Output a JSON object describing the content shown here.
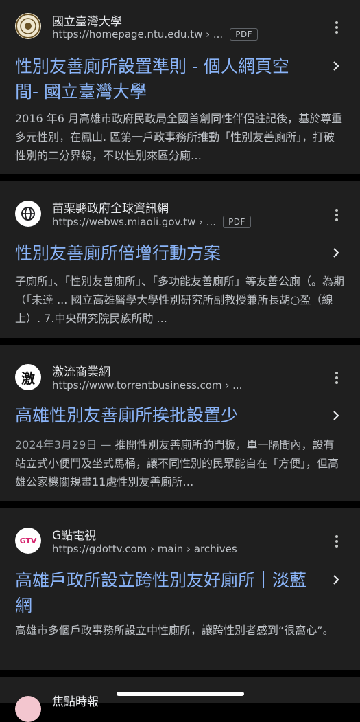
{
  "results": [
    {
      "site_name": "國立臺灣大學",
      "url": "https://homepage.ntu.edu.tw › ...",
      "badge": "PDF",
      "favicon": "ntu-seal-icon",
      "title": "性別友善廁所設置準則 - 個人網頁空間- 國立臺灣大學",
      "snippet": "2016 年6 月高雄市政府民政局全國首創同性伴侶註記後，基於尊重多元性別，在鳳山. 區第一戶政事務所推動「性別友善廁所」，打破性別的二分界線，不以性別來區分廁…"
    },
    {
      "site_name": "苗栗縣政府全球資訊網",
      "url": "https://webws.miaoli.gov.tw › ...",
      "badge": "PDF",
      "favicon": "globe-icon",
      "title": "性別友善廁所倍增行動方案",
      "snippet": "子廁所」、「性別友善廁所」、「多功能友善廁所」等友善公廁（。為期（「未達 ... 國立高雄醫學大學性別研究所副教授兼所長胡○盈（線上）. 7.中央研究院民族所助 ..."
    },
    {
      "site_name": "激流商業網",
      "url": "https://www.torrentbusiness.com › ...",
      "favicon": "torrent-business-logo-icon",
      "favicon_text": "激",
      "title": "高雄性別友善廁所挨批設置少",
      "date": "2024年3月29日 — ",
      "snippet": "推開性別友善廁所的門板，單一隔間內，設有站立式小便鬥及坐式馬桶，讓不同性別的民眾能自在「方便」，但高雄公家機關規畫11處性別友善廁所…"
    },
    {
      "site_name": "G點電視",
      "url": "https://gdottv.com › main › archives",
      "favicon": "gtv-logo-icon",
      "favicon_text": "GTV",
      "title": "高雄戶政所設立跨性別友好廁所｜淡藍網",
      "snippet": "高雄市多個戶政事務所設立中性廁所，讓跨性別者感到“很窩心”。"
    },
    {
      "site_name": "焦點時報",
      "favicon": "focus-news-logo-icon"
    }
  ],
  "colors": {
    "background": "#000000",
    "card": "#1f1f1f",
    "link": "#8ab4f8",
    "text": "#bdc1c6"
  }
}
